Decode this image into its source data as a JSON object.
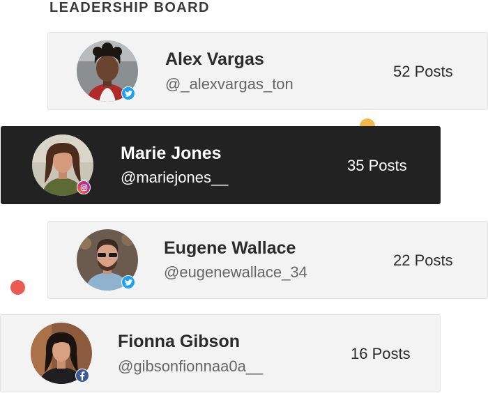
{
  "board": {
    "title": "LEADERSHIP BOARD"
  },
  "colors": {
    "dark_card": "#222222",
    "light_card": "#f3f3f3",
    "dot_yellow": "#f2b84b",
    "dot_red": "#ec5a53",
    "twitter": "#1da1f2",
    "facebook": "#3b5998",
    "instagram": "#d62976"
  },
  "entries": [
    {
      "name": "Alex Vargas",
      "handle": "@_alexvargas_ton",
      "posts": "52 Posts",
      "network_icon": "twitter-icon"
    },
    {
      "name": "Marie Jones",
      "handle": "@mariejones__",
      "posts": "35 Posts",
      "network_icon": "instagram-icon"
    },
    {
      "name": "Eugene Wallace",
      "handle": "@eugenewallace_34",
      "posts": "22 Posts",
      "network_icon": "twitter-icon"
    },
    {
      "name": "Fionna Gibson",
      "handle": "@gibsonfionnaa0a__",
      "posts": "16 Posts",
      "network_icon": "facebook-icon"
    }
  ]
}
